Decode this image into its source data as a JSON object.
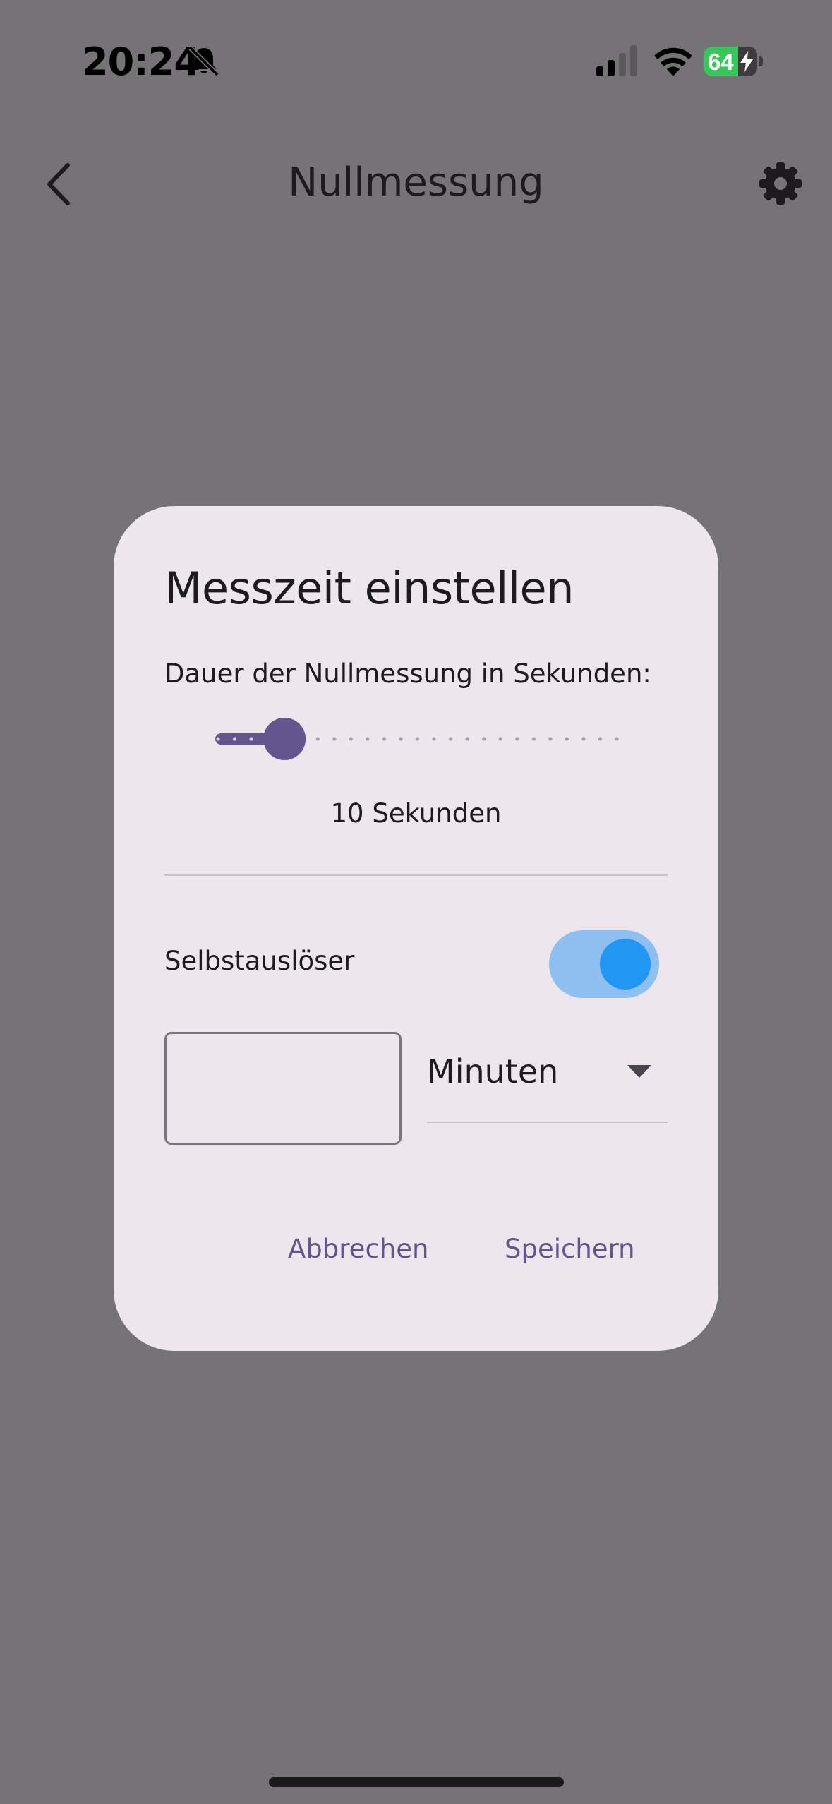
{
  "status_bar": {
    "time": "20:24",
    "battery_level": "64",
    "icons": [
      "bell-slash-icon",
      "cellular-signal-icon",
      "wifi-icon",
      "battery-charging-icon"
    ]
  },
  "app_bar": {
    "title": "Nullmessung",
    "back_icon": "chevron-left-icon",
    "settings_icon": "gear-icon"
  },
  "dialog": {
    "title": "Messzeit einstellen",
    "slider_label": "Dauer der Nullmessung in Sekunden:",
    "slider": {
      "value": 10,
      "min": 0,
      "max": 60,
      "divisions": 24
    },
    "slider_value_text": "10 Sekunden",
    "toggle_label": "Selbstauslöser",
    "toggle_on": true,
    "duration_input": {
      "value": "",
      "placeholder": ""
    },
    "unit_select": {
      "selected": "Minuten"
    },
    "cancel_label": "Abbrechen",
    "save_label": "Speichern"
  },
  "colors": {
    "scrim_background": "#757376",
    "dialog_surface": "#ede6ed",
    "primary": "#65558f",
    "switch_track": "#8dbff0",
    "switch_thumb": "#2196f3",
    "battery_green": "#35c759"
  }
}
